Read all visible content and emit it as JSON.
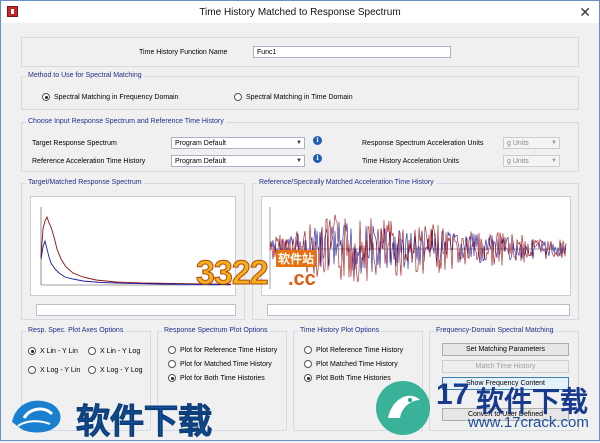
{
  "window": {
    "title": "Time History Matched to Response Spectrum",
    "close_glyph": "✕"
  },
  "function_name": {
    "label": "Time History Function Name",
    "value": "Func1"
  },
  "method": {
    "legend": "Method to Use for Spectral Matching",
    "options": [
      {
        "label": "Spectral Matching in Frequency Domain",
        "selected": true
      },
      {
        "label": "Spectral Matching in Time Domain",
        "selected": false
      }
    ]
  },
  "inputs": {
    "legend": "Choose Input Response Spectrum and Reference Time History",
    "target_label": "Target Response Spectrum",
    "target_value": "Program Default",
    "reference_label": "Reference Acceleration Time History",
    "reference_value": "Program Default",
    "rs_units_label": "Response Spectrum Acceleration Units",
    "rs_units_value": "g Units",
    "th_units_label": "Time History Acceleration Units",
    "th_units_value": "g Units",
    "info_glyph": "i"
  },
  "plots": {
    "left_legend": "Target/Matched Response Spectrum",
    "right_legend": "Reference/Spectrally Matched Acceleration Time History",
    "colors": {
      "target": "#8b1010",
      "matched": "#1c1c9c",
      "reference": "#1c1c9c",
      "spectral": "#a31515"
    }
  },
  "axes_options": {
    "legend": "Resp. Spec. Plot Axes Options",
    "options": [
      {
        "label": "X Lin - Y Lin",
        "selected": true
      },
      {
        "label": "X Lin - Y Log",
        "selected": false
      },
      {
        "label": "X Log - Y Lin",
        "selected": false
      },
      {
        "label": "X Log - Y Log",
        "selected": false
      }
    ]
  },
  "rs_plot_options": {
    "legend": "Response Spectrum Plot Options",
    "options": [
      {
        "label": "Plot for Reference Time History",
        "selected": false
      },
      {
        "label": "Plot for Matched Time History",
        "selected": false
      },
      {
        "label": "Plot for Both Time Histories",
        "selected": true
      }
    ]
  },
  "th_plot_options": {
    "legend": "Time History Plot Options",
    "options": [
      {
        "label": "Plot Reference Time History",
        "selected": false
      },
      {
        "label": "Plot Matched Time History",
        "selected": false
      },
      {
        "label": "Plot Both Time Histories",
        "selected": true
      }
    ]
  },
  "fd_matching": {
    "legend": "Frequency-Domain Spectral Matching",
    "set_params": "Set Matching Parameters",
    "match": "Match Time History",
    "show_content": "Show Frequency Content",
    "convert": "Convert to User Defined"
  },
  "watermarks": {
    "site1_digits": "3322",
    "site1_domain": ".cc",
    "site1_tag": "软件站",
    "site2_text": "软件下载",
    "site3_num": "17",
    "site3_text": "软件下载",
    "site3_url": "www.17crack.com"
  }
}
